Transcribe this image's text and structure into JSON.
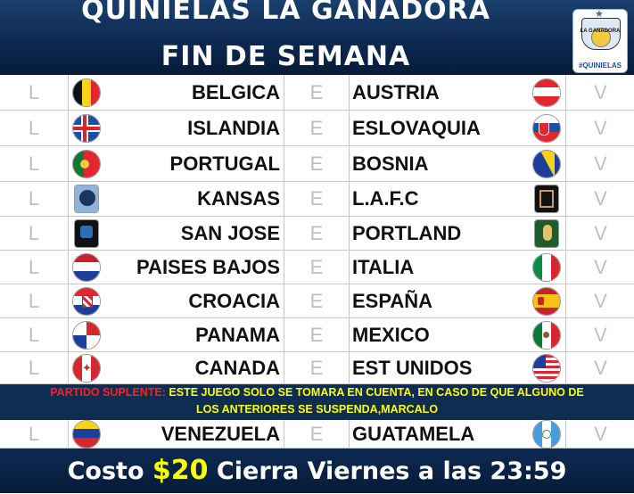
{
  "header": {
    "title_line1": "QUINIELAS LA GANADORA",
    "title_line2": "FIN DE SEMANA",
    "logo_text": "LA GANADORA",
    "logo_hashtag": "#QUINIELAS"
  },
  "columns": {
    "local": "L",
    "empate": "E",
    "visita": "V"
  },
  "matches": [
    {
      "home": "BELGICA",
      "away": "AUSTRIA",
      "home_icon": "belgium-flag-icon",
      "away_icon": "austria-flag-icon"
    },
    {
      "home": "ISLANDIA",
      "away": "ESLOVAQUIA",
      "home_icon": "iceland-flag-icon",
      "away_icon": "slovakia-flag-icon"
    },
    {
      "home": "PORTUGAL",
      "away": "BOSNIA",
      "home_icon": "portugal-flag-icon",
      "away_icon": "bosnia-flag-icon"
    },
    {
      "home": "KANSAS",
      "away": "L.A.F.C",
      "home_icon": "sporting-kc-crest-icon",
      "away_icon": "lafc-crest-icon"
    },
    {
      "home": "SAN JOSE",
      "away": "PORTLAND",
      "home_icon": "san-jose-quakes-crest-icon",
      "away_icon": "portland-timbers-crest-icon"
    },
    {
      "home": "PAISES BAJOS",
      "away": "ITALIA",
      "home_icon": "netherlands-flag-icon",
      "away_icon": "italy-flag-icon"
    },
    {
      "home": "CROACIA",
      "away": "ESPAÑA",
      "home_icon": "croatia-flag-icon",
      "away_icon": "spain-flag-icon"
    },
    {
      "home": "PANAMA",
      "away": "MEXICO",
      "home_icon": "panama-flag-icon",
      "away_icon": "mexico-flag-icon"
    },
    {
      "home": "CANADA",
      "away": "EST UNIDOS",
      "home_icon": "canada-flag-icon",
      "away_icon": "usa-flag-icon"
    }
  ],
  "substitute_notice": {
    "label": "PARTIDO SUPLENTE:",
    "text": " ESTE JUEGO SOLO SE TOMARA EN CUENTA, EN CASO DE QUE ALGUNO DE",
    "text2": "LOS ANTERIORES SE SUSPENDA,MARCALO"
  },
  "substitute_match": {
    "home": "VENEZUELA",
    "away": "GUATAMELA",
    "home_icon": "venezuela-flag-icon",
    "away_icon": "guatemala-flag-icon"
  },
  "footer": {
    "pre": "Costo ",
    "price": "$20",
    "post": " Cierra Viernes a las 23:59"
  },
  "colors": {
    "header_bg": "#0d2a52",
    "accent_yellow": "#ffff00",
    "notice_red": "#ff2020"
  }
}
